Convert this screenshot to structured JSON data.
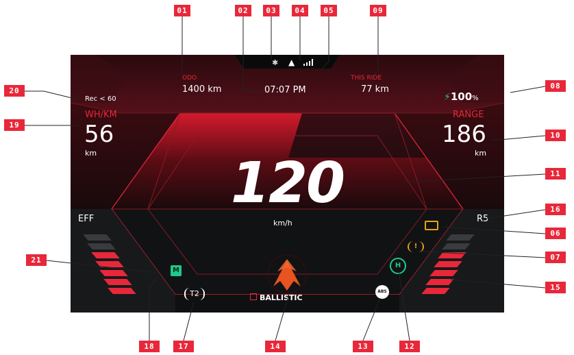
{
  "callouts": [
    "01",
    "02",
    "03",
    "04",
    "05",
    "09",
    "20",
    "19",
    "08",
    "10",
    "11",
    "16",
    "06",
    "07",
    "21",
    "15",
    "18",
    "17",
    "14",
    "13",
    "12"
  ],
  "odo": {
    "label": "ODO",
    "value": "1400 km"
  },
  "clock": "07:07 PM",
  "trip": {
    "label": "THIS RIDE",
    "value": "77 km"
  },
  "status_icons": [
    "bluetooth-icon",
    "navigation-arrow-icon",
    "signal-bars-icon"
  ],
  "left_panel": {
    "rec": "Rec < 60",
    "label": "WH/KM",
    "value": "56",
    "unit": "km"
  },
  "right_panel": {
    "battery": "100",
    "battery_unit": "%",
    "label": "RANGE",
    "value": "186",
    "unit": "km"
  },
  "speed": {
    "value": "120",
    "unit": "km/h"
  },
  "eff_label": "EFF",
  "regen_label": "R5",
  "mode": {
    "name": "BALLISTIC"
  },
  "indicators": {
    "m_label": "M",
    "tpms_label": "T2",
    "abs_label": "ABS",
    "hold_label": "H"
  },
  "eff_bar": {
    "total": 7,
    "lit": 5
  },
  "regen_bar": {
    "total": 7,
    "lit": 5
  },
  "colors": {
    "accent": "#e8283a",
    "bg": "#111214",
    "green": "#1ec98a",
    "amber": "#e8a21c"
  }
}
